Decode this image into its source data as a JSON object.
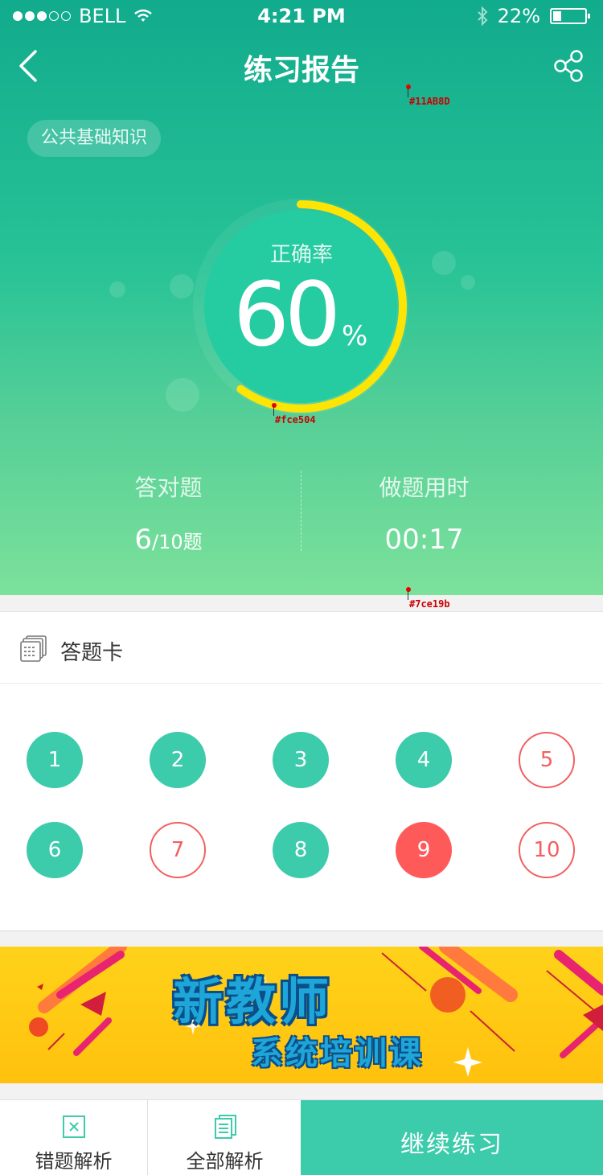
{
  "status_bar": {
    "carrier": "BELL",
    "time": "4:21 PM",
    "battery": "22%"
  },
  "nav": {
    "title": "练习报告"
  },
  "subject_tag": "公共基础知识",
  "score": {
    "label": "正确率",
    "value": "60",
    "unit": "%",
    "fraction": 0.6
  },
  "stats": {
    "correct_label": "答对题",
    "correct_count": "6",
    "correct_total": "/10题",
    "time_label": "做题用时",
    "time_value": "00:17"
  },
  "color_tags": {
    "header": "#11AB8D",
    "arc": "#fce504",
    "bottom": "#7ce19b"
  },
  "answer_card": {
    "title": "答题卡",
    "questions": [
      {
        "n": "1",
        "state": "correct"
      },
      {
        "n": "2",
        "state": "correct"
      },
      {
        "n": "3",
        "state": "correct"
      },
      {
        "n": "4",
        "state": "correct"
      },
      {
        "n": "5",
        "state": "wrong"
      },
      {
        "n": "6",
        "state": "correct"
      },
      {
        "n": "7",
        "state": "wrong"
      },
      {
        "n": "8",
        "state": "correct"
      },
      {
        "n": "9",
        "state": "current"
      },
      {
        "n": "10",
        "state": "wrong"
      }
    ]
  },
  "banner": {
    "line1": "新教师",
    "line2": "系统培训课"
  },
  "bottom": {
    "wrong_analysis": "错题解析",
    "all_analysis": "全部解析",
    "continue": "继续练习"
  },
  "colors": {
    "accent": "#3ccbab",
    "wrong": "#f25f5f",
    "current": "#ff5a5a",
    "arc": "#fce504"
  }
}
